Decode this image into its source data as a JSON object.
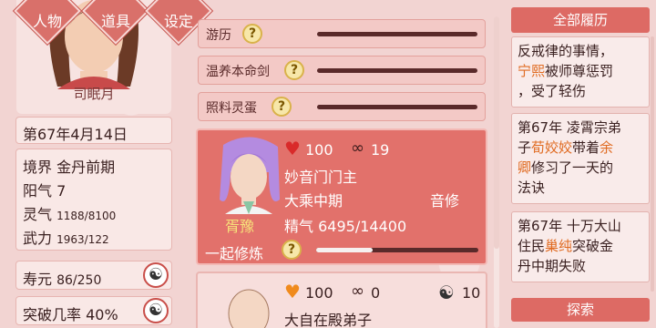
{
  "top_nav": {
    "character": "人物",
    "items": "道具",
    "settings": "设定"
  },
  "player": {
    "name": "司眠月",
    "date": "第67年4月14日",
    "realm_label": "境界",
    "realm_value": "金丹前期",
    "yang_label": "阳气",
    "yang_value": "7",
    "spirit_label": "灵气",
    "spirit_value": "1188/8100",
    "force_label": "武力",
    "force_value": "1963/122",
    "lifespan_label": "寿元",
    "lifespan_value": "86/250",
    "breakthrough_label": "突破几率",
    "breakthrough_value": "40%"
  },
  "activities": [
    {
      "label": "游历",
      "progress": 0.0
    },
    {
      "label": "温养本命剑",
      "progress": 0.0
    },
    {
      "label": "照料灵蛋",
      "progress": 0.0
    }
  ],
  "npc1": {
    "name": "胥豫",
    "affection": "100",
    "bond": "19",
    "title": "妙音门门主",
    "realm": "大乘中期",
    "role": "音修",
    "essence_label": "精气",
    "essence_value": "6495/14400",
    "action_label": "一起修炼",
    "action_progress": 0.35
  },
  "npc2": {
    "affection": "100",
    "bond": "0",
    "extra_value": "10",
    "title": "大自在殿弟子"
  },
  "history": {
    "header": "全部履历",
    "entry0_line1": "反戒律的事情，",
    "entry0_hl": "宁熙",
    "entry0_line2": "被师尊惩罚",
    "entry0_line3": "，受了轻伤",
    "entry1_a": "第67年 凌霄宗弟",
    "entry1_b": "子",
    "entry1_hl1": "荀姣姣",
    "entry1_c": "带着",
    "entry1_hl2": "余",
    "entry1_hl3": "卿",
    "entry1_d": "修习了一天的",
    "entry1_e": "法诀",
    "entry2_a": "第67年 十万大山",
    "entry2_b": "住民",
    "entry2_hl": "巢纯",
    "entry2_c": "突破金",
    "entry2_d": "丹中期失败",
    "footer": "探索"
  },
  "colors": {
    "accent": "#dd6a64",
    "card": "#e2716b",
    "highlight": "#e06b22",
    "heart": "#d92a2a",
    "heart2": "#f08a1c"
  }
}
